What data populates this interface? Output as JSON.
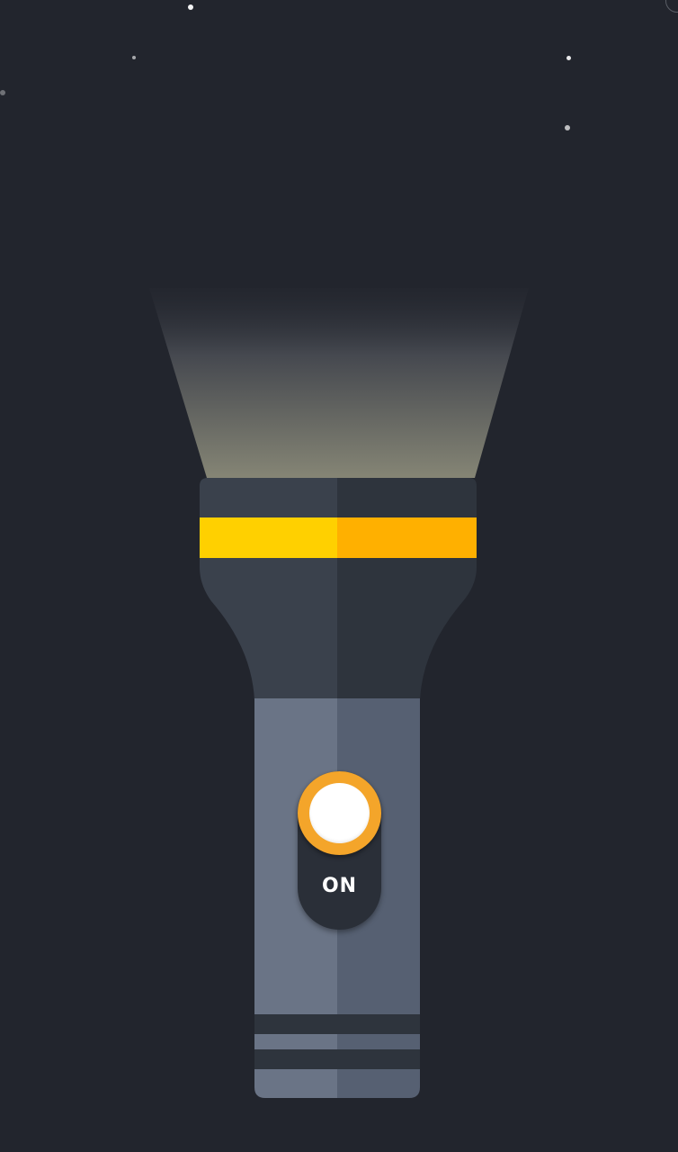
{
  "flashlight": {
    "switch_label": "ON",
    "state": "on"
  },
  "colors": {
    "background": "#22252d",
    "band_left": "#ffd000",
    "band_right": "#ffb000",
    "head_left": "#3a414c",
    "head_right": "#2e343d",
    "handle_left": "#6a7486",
    "handle_right": "#566072",
    "switch_ring": "#f4a52a"
  },
  "icons": {
    "switch_knob": "power-toggle-icon"
  }
}
